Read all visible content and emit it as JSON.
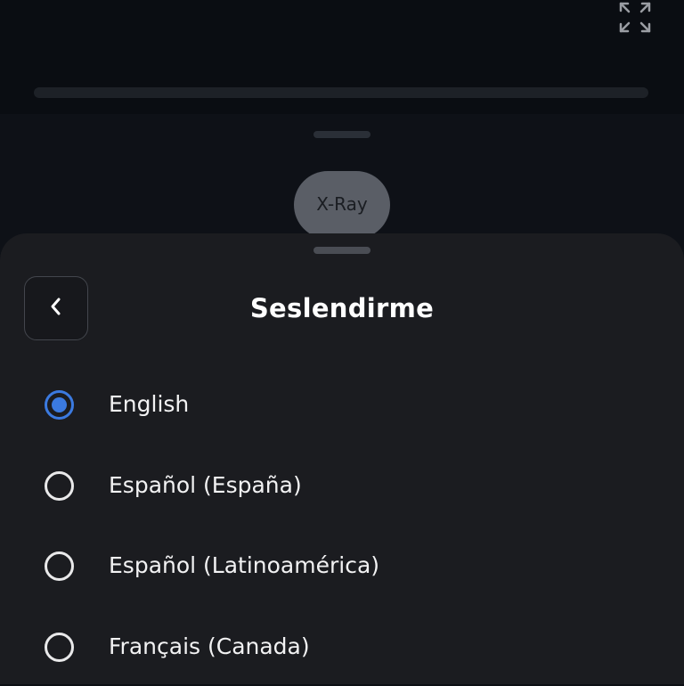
{
  "player": {
    "fullscreen_icon": "expand-icon",
    "xray_label": "X-Ray"
  },
  "sheet": {
    "title": "Seslendirme",
    "back_icon": "chevron-left-icon",
    "options": [
      {
        "label": "English",
        "selected": true
      },
      {
        "label": "Español (España)",
        "selected": false
      },
      {
        "label": "Español (Latinoamérica)",
        "selected": false
      },
      {
        "label": "Français (Canada)",
        "selected": false
      }
    ]
  },
  "colors": {
    "accent": "#3b7ae0",
    "sheet_bg": "#1b1c20",
    "page_bg": "#0c0f14"
  }
}
